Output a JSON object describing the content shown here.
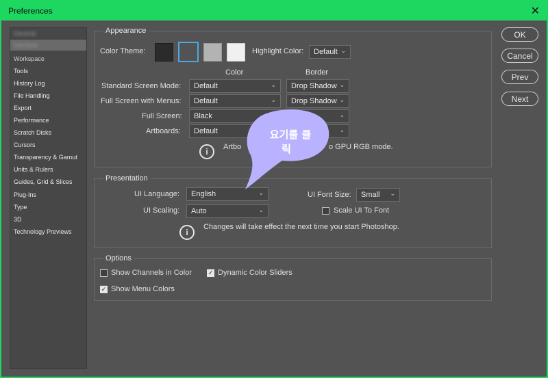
{
  "window": {
    "title": "Preferences",
    "close_glyph": "✕"
  },
  "sidebar": {
    "items": [
      {
        "label": "General"
      },
      {
        "label": "Interface"
      },
      {
        "label": "Workspace"
      },
      {
        "label": "Tools"
      },
      {
        "label": "History Log"
      },
      {
        "label": "File Handling"
      },
      {
        "label": "Export"
      },
      {
        "label": "Performance"
      },
      {
        "label": "Scratch Disks"
      },
      {
        "label": "Cursors"
      },
      {
        "label": "Transparency & Gamut"
      },
      {
        "label": "Units & Rulers"
      },
      {
        "label": "Guides, Grid & Slices"
      },
      {
        "label": "Plug-Ins"
      },
      {
        "label": "Type"
      },
      {
        "label": "3D"
      },
      {
        "label": "Technology Previews"
      }
    ]
  },
  "appearance": {
    "title": "Appearance",
    "color_theme_label": "Color Theme:",
    "themes": [
      "#2b2b2b",
      "#535353",
      "#b3b3b3",
      "#f0f0f0"
    ],
    "selected_theme": 1,
    "highlight_label": "Highlight Color:",
    "highlight_value": "Default",
    "col_color": "Color",
    "col_border": "Border",
    "rows": {
      "standard": {
        "label": "Standard Screen Mode:",
        "color": "Default",
        "border": "Drop Shadow"
      },
      "fullmenus": {
        "label": "Full Screen with Menus:",
        "color": "Default",
        "border": "Drop Shadow"
      },
      "fullscreen": {
        "label": "Full Screen:",
        "color": "Black"
      },
      "artboards": {
        "label": "Artboards:",
        "color": "Default"
      }
    },
    "note_left": "Artbo",
    "note_right": "o GPU RGB mode."
  },
  "presentation": {
    "title": "Presentation",
    "ui_language_label": "UI Language:",
    "ui_language_value": "English",
    "ui_font_size_label": "UI Font Size:",
    "ui_font_size_value": "Small",
    "ui_scaling_label": "UI Scaling:",
    "ui_scaling_value": "Auto",
    "scale_font_label": "Scale UI To Font",
    "scale_font_checked": false,
    "note": "Changes will take effect the next time you start Photoshop."
  },
  "options": {
    "title": "Options",
    "show_channels_label": "Show Channels in Color",
    "show_channels_checked": false,
    "dynamic_sliders_label": "Dynamic Color Sliders",
    "dynamic_sliders_checked": true,
    "show_menu_colors_label": "Show Menu Colors",
    "show_menu_colors_checked": true
  },
  "buttons": {
    "ok": "OK",
    "cancel": "Cancel",
    "prev": "Prev",
    "next": "Next"
  },
  "annotation": {
    "line1": "요기를 클",
    "line2": "릭",
    "color": "#b9b3ff"
  },
  "colors": {
    "title_bar": "#1ed760",
    "panel": "#535353",
    "selected_swatch_border": "#4aa8e8"
  }
}
